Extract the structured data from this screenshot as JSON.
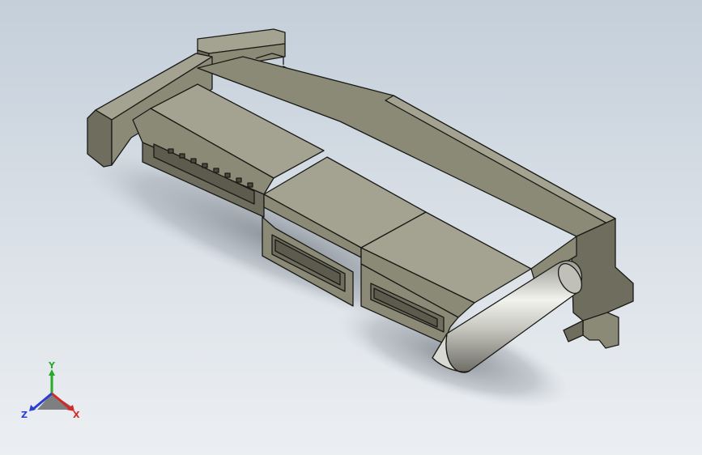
{
  "viewport": {
    "background_top": "#c4cfda",
    "background_bottom": "#eceff2",
    "model": {
      "description_icon": "connector-3d-model",
      "body_color": "#8b8a77",
      "body_top_color": "#a4a391",
      "body_side_color": "#6f6e5e",
      "edge_color": "#1a1a16",
      "guide_pin_color": "#c9c9c3",
      "shadow_color": "#8f939a"
    },
    "triad": {
      "x_label": "X",
      "y_label": "Y",
      "z_label": "Z",
      "x_color": "#d22a2a",
      "y_color": "#2aa82a",
      "z_color": "#2a3fd2"
    }
  }
}
